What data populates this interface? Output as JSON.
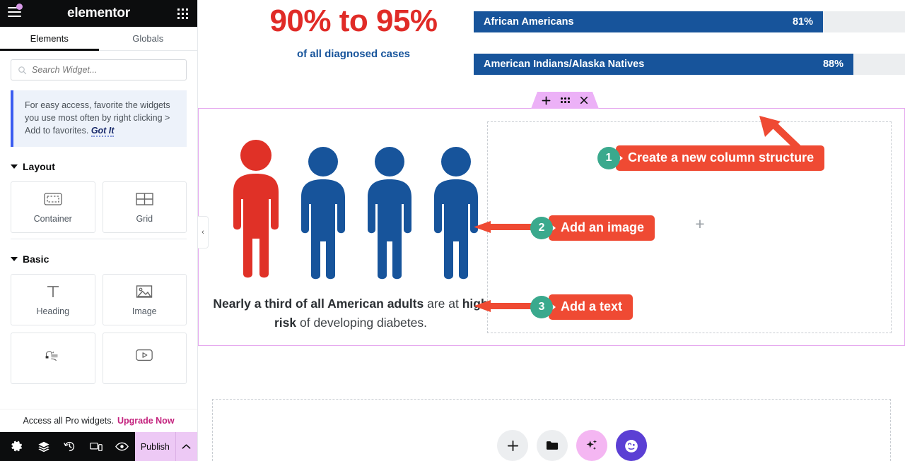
{
  "panel": {
    "brand": "elementor",
    "menu_icon": "hamburger-icon",
    "apps_icon": "apps-grid-icon",
    "tabs": [
      {
        "label": "Elements",
        "active": true
      },
      {
        "label": "Globals",
        "active": false
      }
    ],
    "search": {
      "placeholder": "Search Widget...",
      "value": "",
      "icon": "search-icon"
    },
    "notice": {
      "text_before": "For easy access, favorite the widgets you use most often by right clicking > Add to favorites.",
      "cta": "Got It"
    },
    "sections": [
      {
        "title": "Layout",
        "widgets": [
          {
            "label": "Container",
            "icon": "container-icon"
          },
          {
            "label": "Grid",
            "icon": "grid-icon"
          }
        ]
      },
      {
        "title": "Basic",
        "widgets": [
          {
            "label": "Heading",
            "icon": "heading-text-icon"
          },
          {
            "label": "Image",
            "icon": "image-icon"
          },
          {
            "label": "",
            "icon": "text-editor-icon"
          },
          {
            "label": "",
            "icon": "video-icon"
          }
        ]
      }
    ],
    "pro_banner": {
      "text": "Access all Pro widgets.",
      "cta": "Upgrade Now"
    },
    "footer": {
      "icons": [
        {
          "name": "settings-gear-icon"
        },
        {
          "name": "navigator-layers-icon"
        },
        {
          "name": "history-revisions-icon"
        },
        {
          "name": "responsive-mode-icon"
        },
        {
          "name": "preview-eye-icon"
        }
      ],
      "publish_label": "Publish",
      "publish_toggle_icon": "chevron-up-icon"
    },
    "collapse_icon": "chevron-left-icon"
  },
  "canvas": {
    "stat": {
      "big": "90% to 95%",
      "sub": "of all diagnosed cases",
      "big_color": "#e02b27",
      "sub_color": "#17549b"
    },
    "bars": [
      {
        "label": "African Americans",
        "value": "81%",
        "percent": 81
      },
      {
        "label": "American Indians/Alaska Natives",
        "value": "88%",
        "percent": 88
      }
    ],
    "bar_fill_color": "#17549b",
    "bar_track_color": "#eceef0",
    "section_handle": {
      "add_icon": "plus-icon",
      "drag_icon": "drag-dots-icon",
      "close_icon": "close-x-icon",
      "color": "#ecb1f7"
    },
    "people": {
      "highlight_color": "#e03127",
      "base_color": "#17549b",
      "count": 4,
      "highlighted_index": 0
    },
    "caption": {
      "part1": "Nearly a third of all American adults",
      "part2": " are at ",
      "part3": "high risk",
      "part4": " of developing diabetes."
    },
    "column_plus_icon": "plus-icon",
    "annotations": [
      {
        "number": "1",
        "label": "Create a new column structure"
      },
      {
        "number": "2",
        "label": "Add an image"
      },
      {
        "number": "3",
        "label": "Add a text"
      }
    ],
    "annotation_colors": {
      "badge": "#3aa98d",
      "label": "#ef4a33",
      "arrow": "#ef4a33"
    },
    "fabs": [
      {
        "name": "add-element-fab",
        "icon": "plus-icon",
        "style": "gray"
      },
      {
        "name": "folder-templates-fab",
        "icon": "folder-icon",
        "style": "gray"
      },
      {
        "name": "ai-sparkles-fab",
        "icon": "sparkles-icon",
        "style": "pink"
      },
      {
        "name": "assistant-face-fab",
        "icon": "winking-face-icon",
        "style": "purple"
      }
    ]
  }
}
